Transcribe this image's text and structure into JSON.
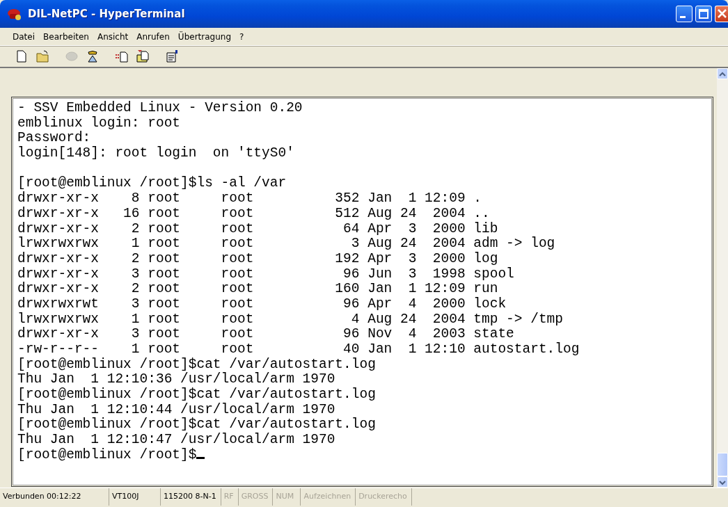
{
  "window": {
    "title": "DIL-NetPC - HyperTerminal"
  },
  "menu": [
    {
      "label": "Datei"
    },
    {
      "label": "Bearbeiten"
    },
    {
      "label": "Ansicht"
    },
    {
      "label": "Anrufen"
    },
    {
      "label": "Übertragung"
    },
    {
      "label": "?"
    }
  ],
  "toolbar": [
    {
      "kind": "new",
      "disabled": false
    },
    {
      "kind": "open",
      "disabled": false
    },
    {
      "kind": "call",
      "disabled": true
    },
    {
      "kind": "hangup",
      "disabled": false
    },
    {
      "kind": "send",
      "disabled": false
    },
    {
      "kind": "receive",
      "disabled": false
    },
    {
      "kind": "properties",
      "disabled": false
    }
  ],
  "terminal": {
    "cursor_visible": true,
    "lines": [
      {
        "kind": "text",
        "text": "- SSV Embedded Linux - Version 0.20"
      },
      {
        "kind": "text",
        "text": "emblinux login: root"
      },
      {
        "kind": "text",
        "text": "Password:"
      },
      {
        "kind": "text",
        "text": "login[148]: root login  on 'ttyS0'"
      },
      {
        "kind": "blank"
      },
      {
        "kind": "text",
        "text": "[root@emblinux /root]$ls -al /var"
      },
      {
        "kind": "text",
        "text": "drwxr-xr-x    8 root     root          352 Jan  1 12:09 ."
      },
      {
        "kind": "text",
        "text": "drwxr-xr-x   16 root     root          512 Aug 24  2004 .."
      },
      {
        "kind": "text",
        "text": "drwxr-xr-x    2 root     root           64 Apr  3  2000 lib"
      },
      {
        "kind": "text",
        "text": "lrwxrwxrwx    1 root     root            3 Aug 24  2004 adm -> log"
      },
      {
        "kind": "text",
        "text": "drwxr-xr-x    2 root     root          192 Apr  3  2000 log"
      },
      {
        "kind": "text",
        "text": "drwxr-xr-x    3 root     root           96 Jun  3  1998 spool"
      },
      {
        "kind": "text",
        "text": "drwxr-xr-x    2 root     root          160 Jan  1 12:09 run"
      },
      {
        "kind": "text",
        "text": "drwxrwxrwt    3 root     root           96 Apr  4  2000 lock"
      },
      {
        "kind": "text",
        "text": "lrwxrwxrwx    1 root     root            4 Aug 24  2004 tmp -> /tmp"
      },
      {
        "kind": "text",
        "text": "drwxr-xr-x    3 root     root           96 Nov  4  2003 state"
      },
      {
        "kind": "text",
        "text": "-rw-r--r--    1 root     root           40 Jan  1 12:10 autostart.log"
      },
      {
        "kind": "text",
        "text": "[root@emblinux /root]$cat /var/autostart.log"
      },
      {
        "kind": "text",
        "text": "Thu Jan  1 12:10:36 /usr/local/arm 1970"
      },
      {
        "kind": "text",
        "text": "[root@emblinux /root]$cat /var/autostart.log"
      },
      {
        "kind": "text",
        "text": "Thu Jan  1 12:10:44 /usr/local/arm 1970"
      },
      {
        "kind": "text",
        "text": "[root@emblinux /root]$cat /var/autostart.log"
      },
      {
        "kind": "text",
        "text": "Thu Jan  1 12:10:47 /usr/local/arm 1970"
      },
      {
        "kind": "text",
        "text": "[root@emblinux /root]$"
      }
    ]
  },
  "status_bar": [
    {
      "text": "Verbunden 00:12:22",
      "enabled": true
    },
    {
      "text": "VT100J",
      "enabled": true
    },
    {
      "text": "115200 8-N-1",
      "enabled": true
    },
    {
      "text": "RF",
      "enabled": false
    },
    {
      "text": "GROSS",
      "enabled": false
    },
    {
      "text": "NUM",
      "enabled": false
    },
    {
      "text": "Aufzeichnen",
      "enabled": false
    },
    {
      "text": "Druckerecho",
      "enabled": false
    }
  ]
}
